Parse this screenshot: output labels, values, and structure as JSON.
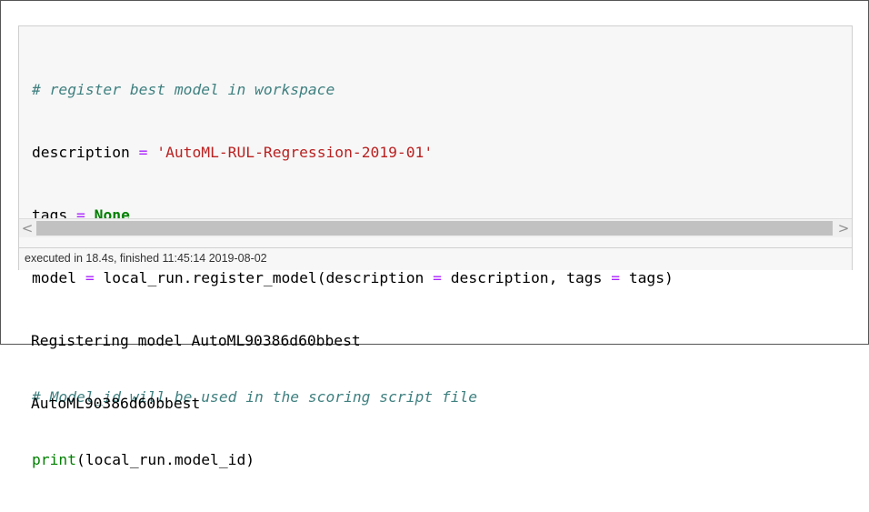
{
  "cell": {
    "code": {
      "line1": "# register best model in workspace",
      "line2": {
        "var": "description",
        "op": "=",
        "string": "'AutoML-RUL-Regression-2019-01'"
      },
      "line3": {
        "var": "tags",
        "op": "=",
        "keyword": "None"
      },
      "line4": {
        "var": "model",
        "op": "=",
        "call_start": "local_run.register_model(description ",
        "op2": "=",
        "mid": " description, tags ",
        "op3": "=",
        "end": " tags)"
      },
      "line5": "# Model_id will be used in the scoring script file",
      "line6": {
        "builtin": "print",
        "rest": "(local_run.model_id)"
      }
    },
    "scrollbar": {
      "left_arrow": "<",
      "right_arrow": ">"
    },
    "timing": "executed in 18.4s, finished 11:45:14 2019-08-02"
  },
  "output": [
    "Registering model AutoML90386d60bbest",
    "AutoML90386d60bbest"
  ],
  "colors": {
    "comment": "#408080",
    "string": "#ba2121",
    "keyword": "#008000",
    "operator": "#aa22ff",
    "cell_background": "#f7f7f7",
    "cell_border": "#cfcfcf"
  }
}
